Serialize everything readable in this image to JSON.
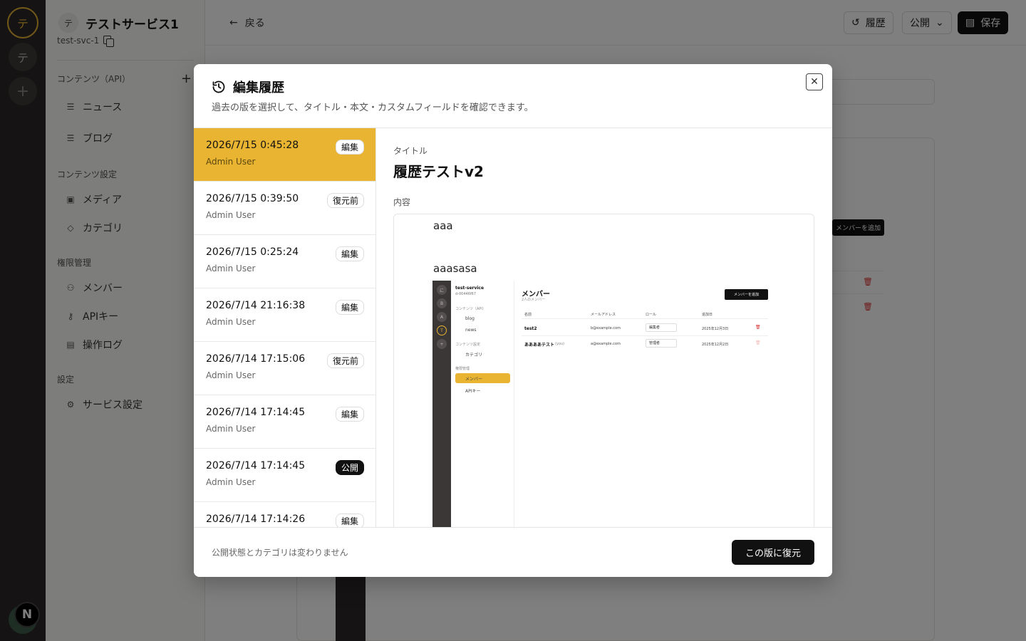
{
  "rail": {
    "items": [
      "テ",
      "テ",
      "+"
    ],
    "bottom_avatar": "N"
  },
  "sidebar": {
    "service_avatar": "テ",
    "service_name": "テストサービス1",
    "service_id": "test-svc-1",
    "sections": {
      "contents_api": "コンテンツ（API）",
      "contents_settings": "コンテンツ設定",
      "permissions": "権限管理",
      "settings": "設定"
    },
    "items": {
      "news": "ニュース",
      "blog": "ブログ",
      "media": "メディア",
      "category": "カテゴリ",
      "members": "メンバー",
      "api_keys": "APIキー",
      "audit_log": "操作ログ",
      "service_settings": "サービス設定"
    },
    "add_icon": "+"
  },
  "topbar": {
    "back_label": "戻る",
    "history_label": "履歴",
    "publish_label": "公開",
    "save_label": "保存"
  },
  "background": {
    "add_member_tag": "メンバーを追加"
  },
  "modal": {
    "title": "編集履歴",
    "description": "過去の版を選択して、タイトル・本文・カスタムフィールドを確認できます。",
    "versions": [
      {
        "date": "2026/7/15 0:45:28",
        "user": "Admin User",
        "badge": "編集",
        "selected": true
      },
      {
        "date": "2026/7/15 0:39:50",
        "user": "Admin User",
        "badge": "復元前"
      },
      {
        "date": "2026/7/15 0:25:24",
        "user": "Admin User",
        "badge": "編集"
      },
      {
        "date": "2026/7/14 21:16:38",
        "user": "Admin User",
        "badge": "編集"
      },
      {
        "date": "2026/7/14 17:15:06",
        "user": "Admin User",
        "badge": "復元前"
      },
      {
        "date": "2026/7/14 17:14:45",
        "user": "Admin User",
        "badge": "編集"
      },
      {
        "date": "2026/7/14 17:14:45",
        "user": "Admin User",
        "badge": "公開"
      },
      {
        "date": "2026/7/14 17:14:26",
        "user": "Admin User",
        "badge": "編集"
      }
    ],
    "detail": {
      "title_label": "タイトル",
      "title_value": "履歴テストv2",
      "content_label": "内容",
      "paragraph1": "aaa",
      "paragraph2": "aaasasa"
    },
    "embedded_screenshot": {
      "rail_items": [
        "に",
        "B",
        "A",
        "T",
        "+"
      ],
      "service_name": "test-service",
      "service_id": "d-00446f67",
      "section_api": "コンテンツ（API）",
      "item_blog": "blog",
      "item_news": "news",
      "section_settings": "コンテンツ設定",
      "item_category": "カテゴリ",
      "section_perm": "権限管理",
      "item_member": "メンバー",
      "item_api": "APIキー",
      "page_title": "メンバー",
      "page_subtitle": "2人のメンバー",
      "add_button": "メンバーを追加",
      "columns": [
        "名前",
        "メールアドレス",
        "ロール",
        "追加日"
      ],
      "rows": [
        {
          "name": "test2",
          "email": "b@example.com",
          "role": "編集者",
          "date": "2025年12月3日"
        },
        {
          "name": "ああああテスト",
          "you": "(you)",
          "email": "a@example.com",
          "role": "管理者",
          "date": "2025年12月2日"
        }
      ]
    },
    "footer_note": "公開状態とカテゴリは変わりません",
    "restore_button": "この版に復元"
  }
}
